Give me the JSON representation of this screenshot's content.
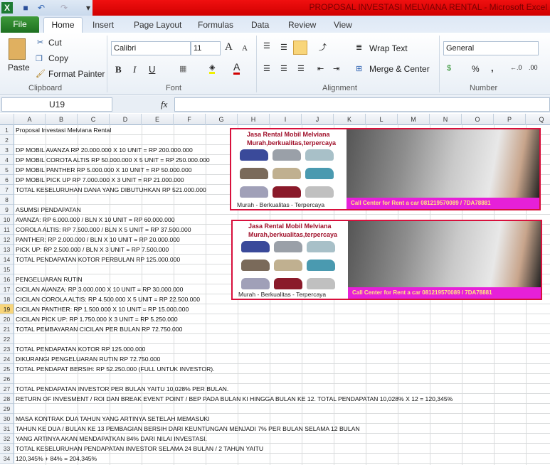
{
  "window": {
    "title": "PROPOSAL INVESTASI MELVIANA RENTAL  -  Microsoft Excel"
  },
  "quick_access": {
    "icons": [
      "excel-logo-icon",
      "save-icon",
      "undo-icon",
      "redo-icon",
      "customize-icon"
    ]
  },
  "tabs": [
    "File",
    "Home",
    "Insert",
    "Page Layout",
    "Formulas",
    "Data",
    "Review",
    "View"
  ],
  "ribbon": {
    "clipboard": {
      "label": "Clipboard",
      "paste": "Paste",
      "cut": "Cut",
      "copy": "Copy",
      "format_painter": "Format Painter"
    },
    "font": {
      "label": "Font",
      "font_name": "Calibri",
      "font_size": "11",
      "bold": "B",
      "italic": "I",
      "underline": "U"
    },
    "alignment": {
      "label": "Alignment",
      "wrap_text": "Wrap Text",
      "merge_center": "Merge & Center"
    },
    "number": {
      "label": "Number",
      "format": "General",
      "percent": "%",
      "comma": ","
    }
  },
  "formula_bar": {
    "name_box": "U19",
    "fx": "fx",
    "value": ""
  },
  "columns": [
    "A",
    "B",
    "C",
    "D",
    "E",
    "F",
    "G",
    "H",
    "I",
    "J",
    "K",
    "L",
    "M",
    "N",
    "O",
    "P",
    "Q"
  ],
  "selected_row": 19,
  "rows": [
    "Proposal Investasi Melviana Rental",
    "",
    "DP MOBIL AVANZA RP 20.000.000 X 10 UNIT = RP 200.000.000",
    "DP MOBIL COROTA ALTIS RP 50.000.000 X 5 UNIT = RP 250.000.000",
    "DP MOBIL PANTHER RP 5.000.000 X 10 UNIT = RP 50.000.000",
    "DP MOBIL PICK UP RP 7.000.000 X 3 UNIT = RP 21.000.000",
    "TOTAL KESELURUHAN DANA YANG DIBUTUHKAN RP 521.000.000",
    "",
    "ASUMSI PENDAPATAN",
    "AVANZA: RP 6.000.000 / BLN X 10 UNIT = RP 60.000.000",
    "COROLA ALTIS: RP 7.500.000 / BLN X 5 UNIT = RP 37.500.000",
    "PANTHER: RP 2.000.000 / BLN X 10 UNIT = RP 20.000.000",
    "PICK UP: RP 2.500.000 / BLN X 3 UNIT = RP 7.500.000",
    "TOTAL PENDAPATAN KOTOR PERBULAN RP 125.000.000",
    "",
    "PENGELUARAN RUTIN",
    "CICILAN AVANZA: RP 3.000.000 X 10 UNIT = RP 30.000.000",
    "CICILAN COROLA ALTIS: RP 4.500.000 X 5 UNIT = RP 22.500.000",
    "CICILAN PANTHER: RP 1.500.000 X 10 UNIT = RP 15.000.000",
    "CICILAN PICK UP: RP 1.750.000 X 3 UNIT = RP 5.250.000",
    "TOTAL PEMBAYARAN CICILAN PER BULAN RP 72.750.000",
    "",
    "TOTAL PENDAPATAN KOTOR RP 125.000.000",
    "DIKURANGI PENGELUARAN RUTIN RP 72.750.000",
    "TOTAL PENDAPAT BERSIH: RP 52.250.000 (FULL UNTUK INVESTOR).",
    "",
    "TOTAL PENDAPATAN INVESTOR PER BULAN YAITU 10,028% PER BULAN.",
    "RETURN OF INVESMENT / ROI DAN BREAK EVENT POINT / BEP PADA BULAN KI HINGGA BULAN KE 12. TOTAL PENDAPATAN 10,028% X 12 =  120,345%",
    "",
    "MASA KONTRAK DUA TAHUN YANG ARTINYA SETELAH MEMASUKI",
    "TAHUN KE DUA / BULAN KE 13 PEMBAGIAN BERSIH DARI KEUNTUNGAN MENJADI 7% PER BULAN SELAMA 12 BULAN",
    "YANG ARTINYA AKAN MENDAPATKAN 84% DARI NILAI INVESTASI.",
    "TOTAL KESELURUHAN PENDAPATAN INVESTOR SELAMA 24 BULAN / 2 TAHUN YAITU",
    "120,345% + 84% = 204,345%"
  ],
  "banner": {
    "line1": "Jasa Rental Mobil Melviana",
    "line2": "Murah,berkualitas,terpercaya",
    "footer": "Murah  -  Berkualitas  -  Terpercaya",
    "call": "Call Center for Rent a car 081219570089 / 7DA78881"
  },
  "colors": {
    "title_bar": "#e00000",
    "file_tab": "#2a7f2a",
    "banner_border": "#d8103c",
    "call_bar": "#e620d8",
    "selected_row": "#f8d57a"
  }
}
